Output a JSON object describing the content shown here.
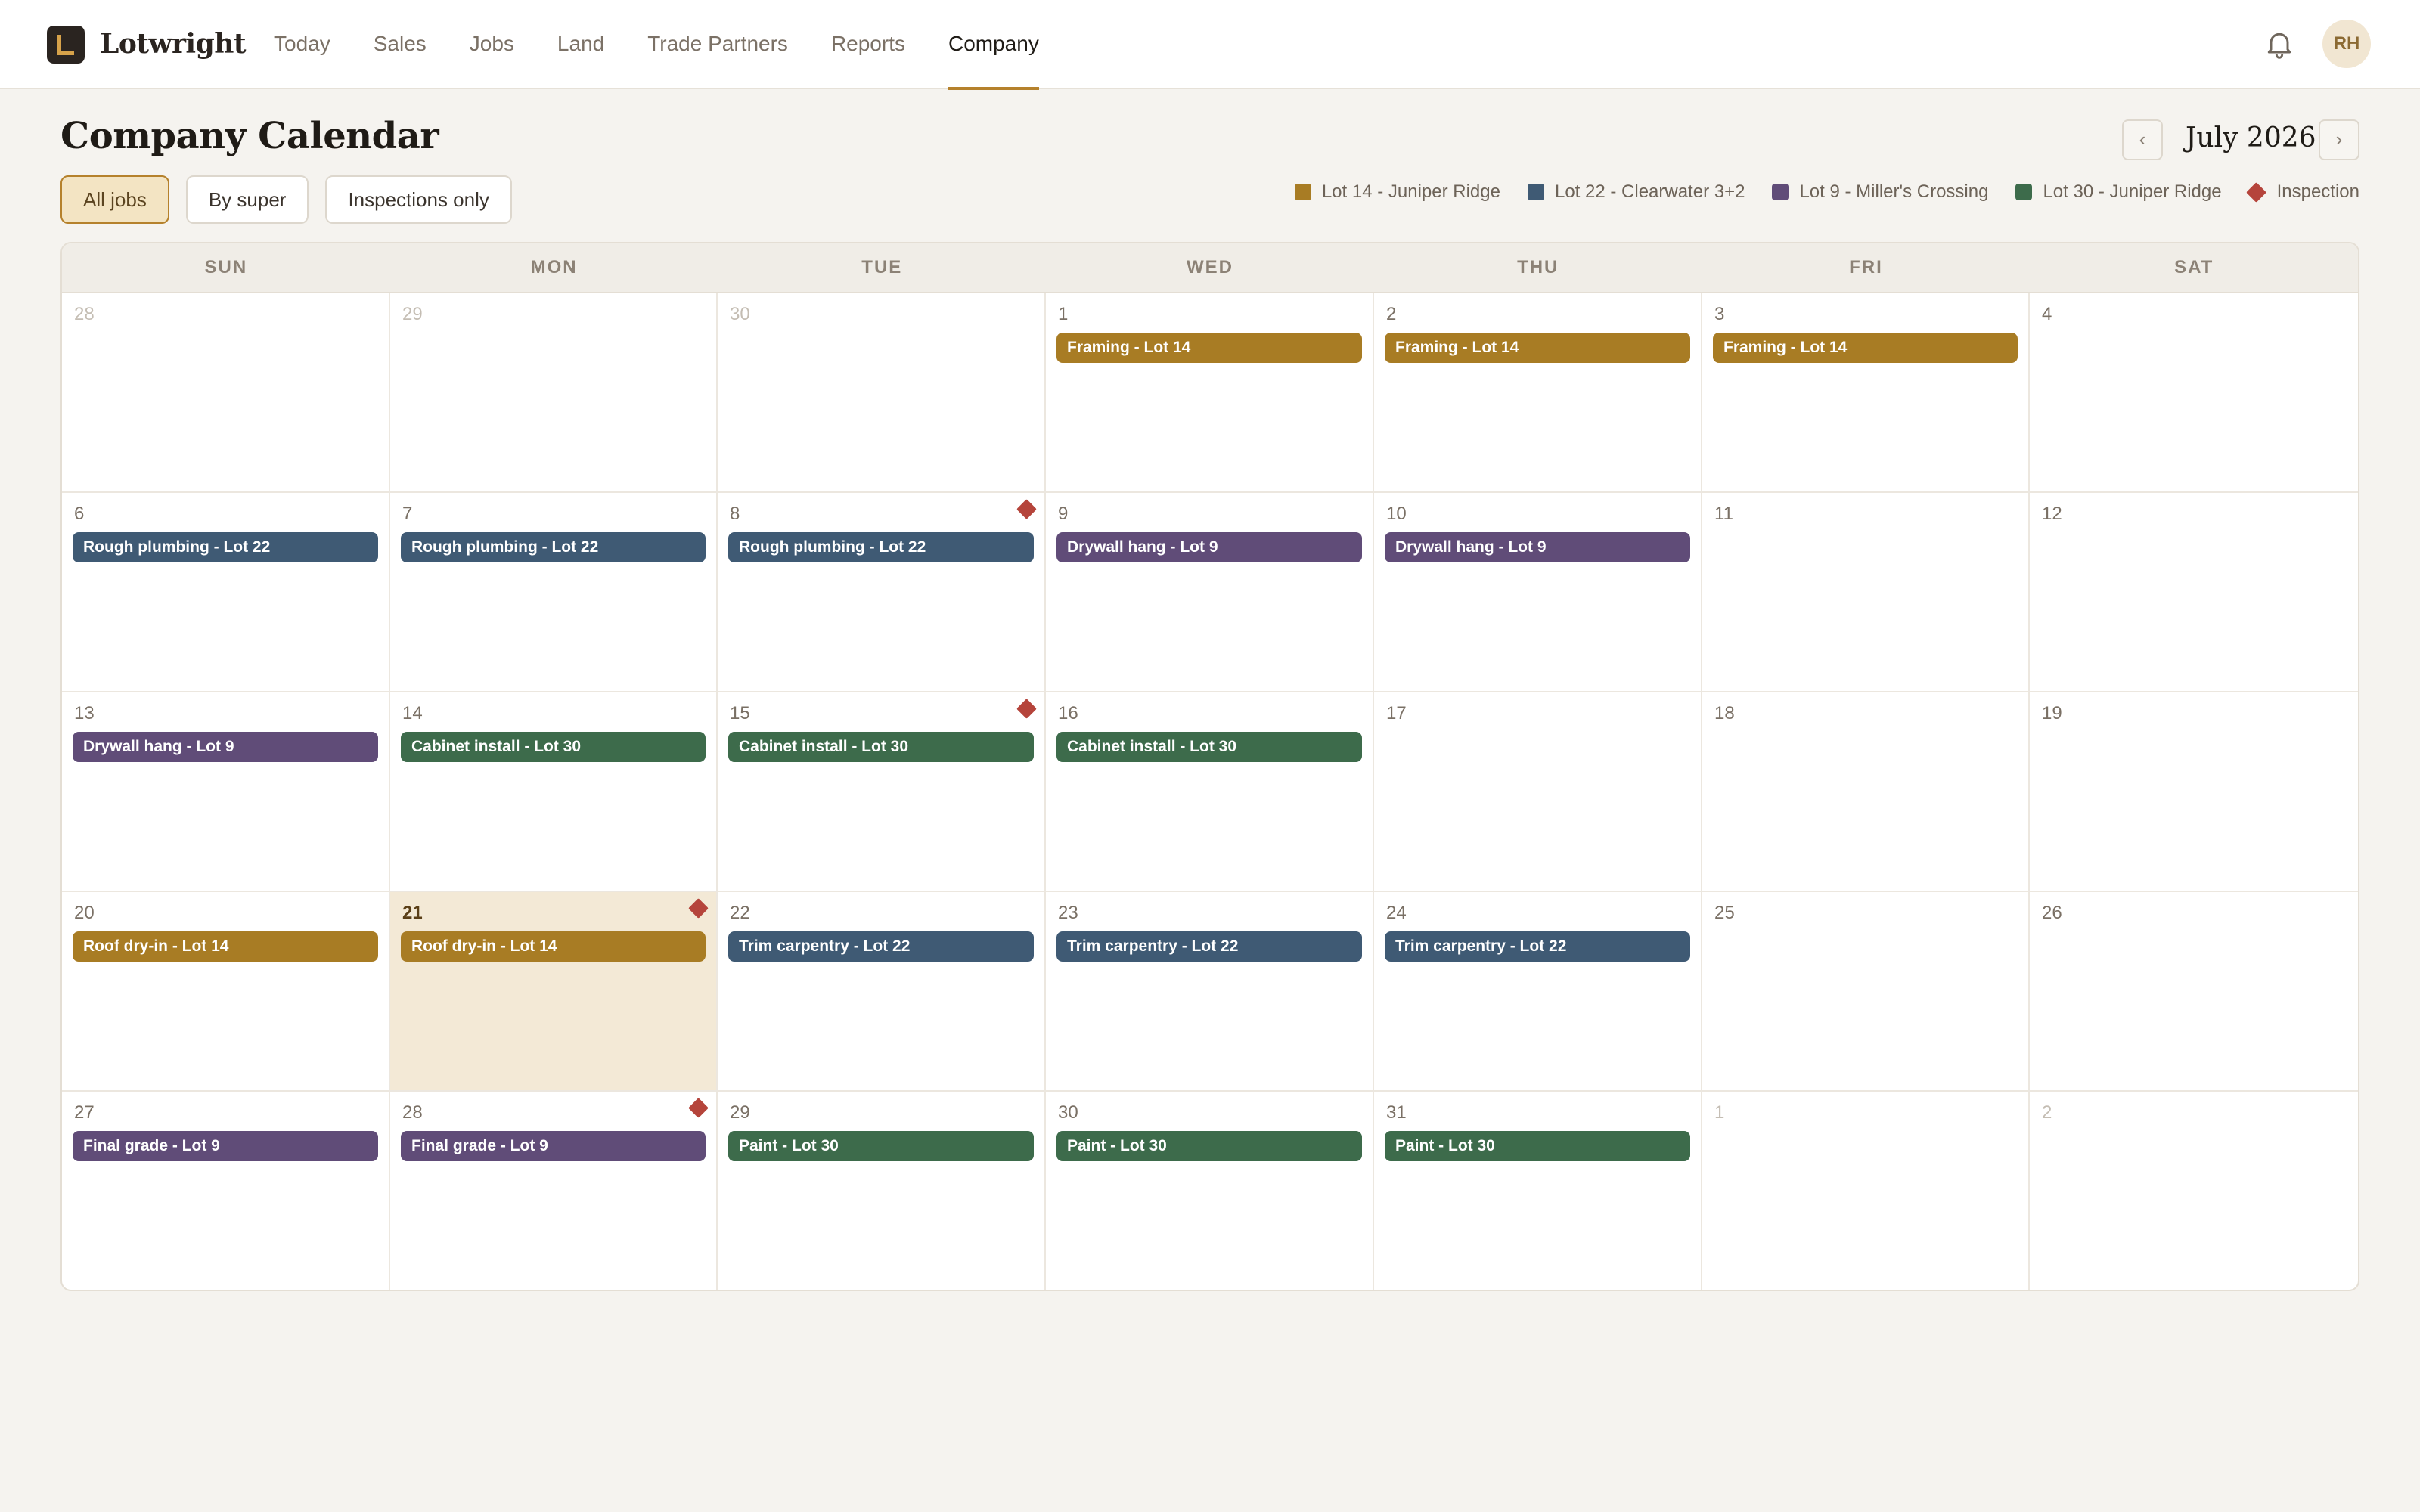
{
  "app": {
    "brand": "Lotwright",
    "user_initials": "RH"
  },
  "nav": {
    "items": [
      "Today",
      "Sales",
      "Jobs",
      "Land",
      "Trade Partners",
      "Reports",
      "Company"
    ],
    "active_index": 6
  },
  "page": {
    "title": "Company Calendar",
    "month": "July 2026",
    "prev_symbol": "‹",
    "next_symbol": "›"
  },
  "filters": {
    "items": [
      "All jobs",
      "By super",
      "Inspections only"
    ],
    "active_index": 0
  },
  "legend": [
    {
      "label": "Lot 14 - Juniper Ridge",
      "color": "#a87c24",
      "kind": "swatch"
    },
    {
      "label": "Lot 22 - Clearwater 3+2",
      "color": "#3f5a74",
      "kind": "swatch"
    },
    {
      "label": "Lot 9 - Miller's Crossing",
      "color": "#604c78",
      "kind": "swatch"
    },
    {
      "label": "Lot 30 - Juniper Ridge",
      "color": "#3d6b4b",
      "kind": "swatch"
    },
    {
      "label": "Inspection",
      "color": "#b5443b",
      "kind": "diamond"
    }
  ],
  "calendar": {
    "weekdays": [
      "SUN",
      "MON",
      "TUE",
      "WED",
      "THU",
      "FRI",
      "SAT"
    ],
    "lot_colors": {
      "lot14": "#a87c24",
      "lot22": "#3f5a74",
      "lot9": "#604c78",
      "lot30": "#3d6b4b"
    },
    "weeks": [
      [
        {
          "day": "28",
          "muted": true
        },
        {
          "day": "29",
          "muted": true
        },
        {
          "day": "30",
          "muted": true
        },
        {
          "day": "1",
          "event": "Framing - Lot 14",
          "lot": "lot14"
        },
        {
          "day": "2",
          "event": "Framing - Lot 14",
          "lot": "lot14"
        },
        {
          "day": "3",
          "event": "Framing - Lot 14",
          "lot": "lot14"
        },
        {
          "day": "4"
        }
      ],
      [
        {
          "day": "6",
          "event": "Rough plumbing - Lot 22",
          "lot": "lot22"
        },
        {
          "day": "7",
          "event": "Rough plumbing - Lot 22",
          "lot": "lot22"
        },
        {
          "day": "8",
          "event": "Rough plumbing - Lot 22",
          "lot": "lot22",
          "inspection": true
        },
        {
          "day": "9",
          "event": "Drywall hang - Lot 9",
          "lot": "lot9"
        },
        {
          "day": "10",
          "event": "Drywall hang - Lot 9",
          "lot": "lot9"
        },
        {
          "day": "11"
        },
        {
          "day": "12"
        }
      ],
      [
        {
          "day": "13",
          "event": "Drywall hang - Lot 9",
          "lot": "lot9"
        },
        {
          "day": "14",
          "event": "Cabinet install - Lot 30",
          "lot": "lot30"
        },
        {
          "day": "15",
          "event": "Cabinet install - Lot 30",
          "lot": "lot30",
          "inspection": true
        },
        {
          "day": "16",
          "event": "Cabinet install - Lot 30",
          "lot": "lot30"
        },
        {
          "day": "17"
        },
        {
          "day": "18"
        },
        {
          "day": "19"
        }
      ],
      [
        {
          "day": "20",
          "event": "Roof dry-in - Lot 14",
          "lot": "lot14"
        },
        {
          "day": "21",
          "event": "Roof dry-in - Lot 14",
          "lot": "lot14",
          "inspection": true,
          "today": true
        },
        {
          "day": "22",
          "event": "Trim carpentry - Lot 22",
          "lot": "lot22"
        },
        {
          "day": "23",
          "event": "Trim carpentry - Lot 22",
          "lot": "lot22"
        },
        {
          "day": "24",
          "event": "Trim carpentry - Lot 22",
          "lot": "lot22"
        },
        {
          "day": "25"
        },
        {
          "day": "26"
        }
      ],
      [
        {
          "day": "27",
          "event": "Final grade - Lot 9",
          "lot": "lot9"
        },
        {
          "day": "28",
          "event": "Final grade - Lot 9",
          "lot": "lot9",
          "inspection": true
        },
        {
          "day": "29",
          "event": "Paint - Lot 30",
          "lot": "lot30"
        },
        {
          "day": "30",
          "event": "Paint - Lot 30",
          "lot": "lot30"
        },
        {
          "day": "31",
          "event": "Paint - Lot 30",
          "lot": "lot30"
        },
        {
          "day": "1",
          "muted": true
        },
        {
          "day": "2",
          "muted": true
        }
      ]
    ]
  }
}
